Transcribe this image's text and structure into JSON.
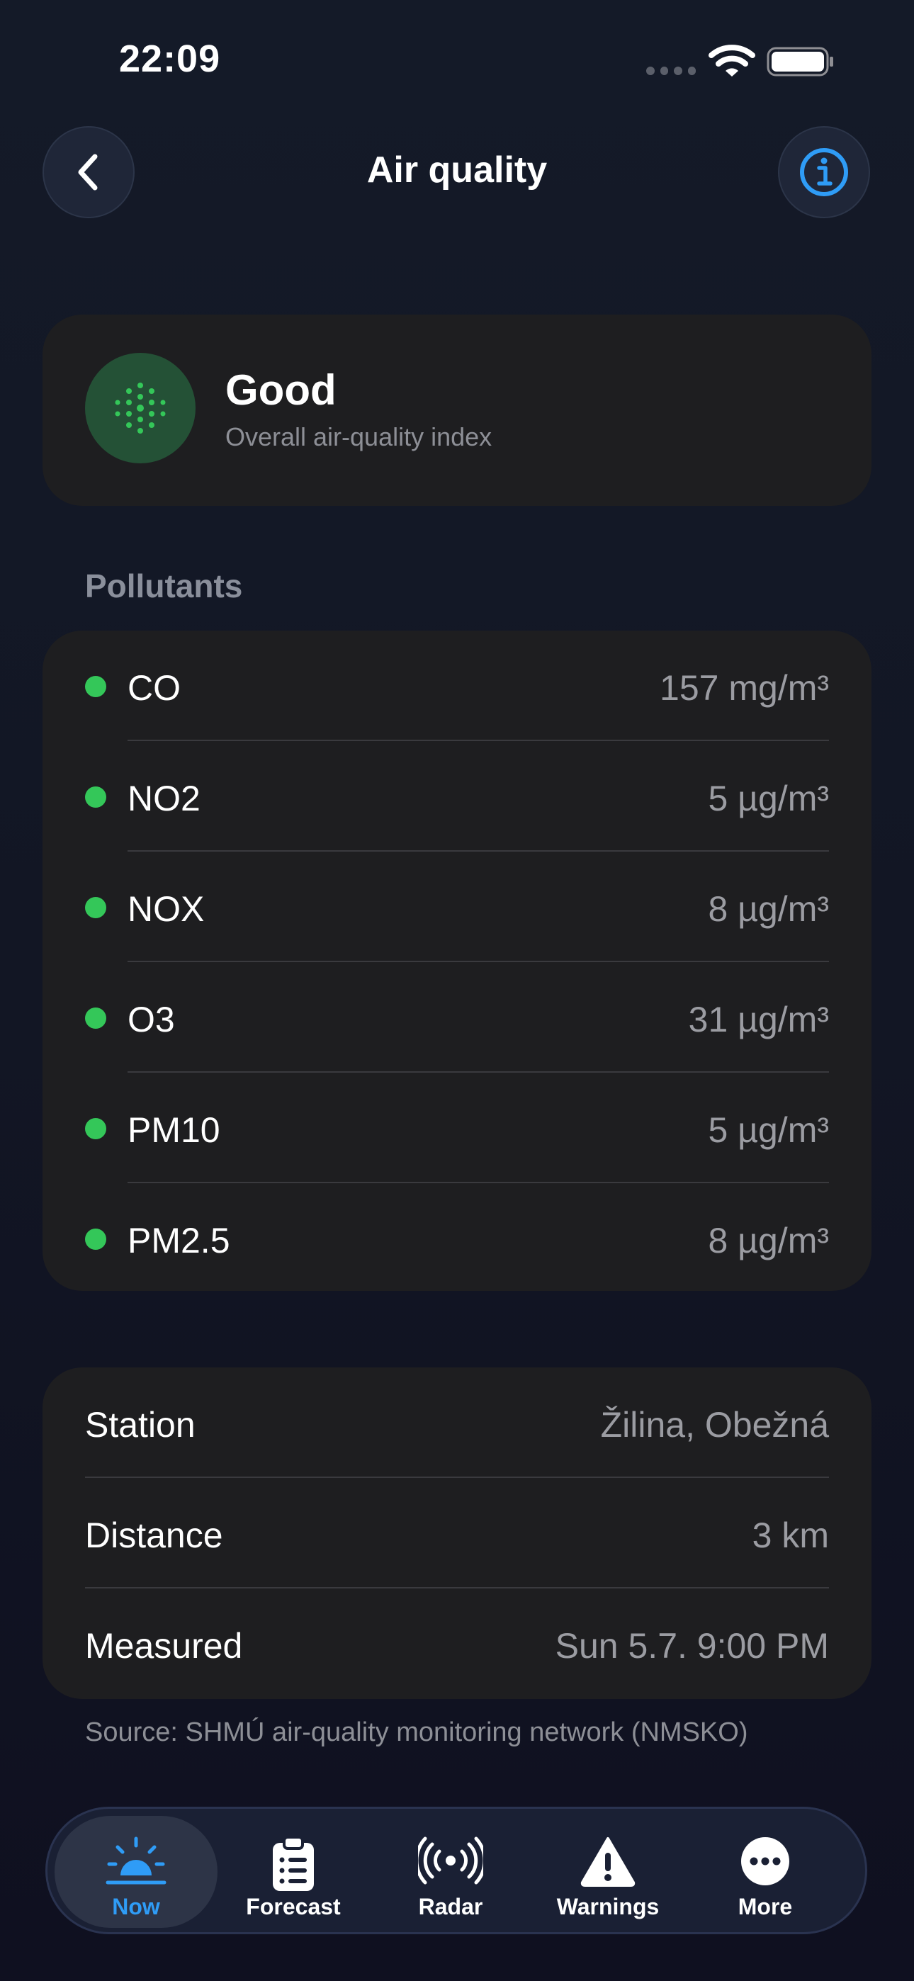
{
  "status_bar": {
    "time": "22:09"
  },
  "header": {
    "title": "Air quality"
  },
  "aqi": {
    "label": "Good",
    "subtitle": "Overall air-quality index",
    "color": "#34c759"
  },
  "pollutants": {
    "section_title": "Pollutants",
    "items": [
      {
        "name": "CO",
        "value": "157 mg/m³"
      },
      {
        "name": "NO2",
        "value": "5 µg/m³"
      },
      {
        "name": "NOX",
        "value": "8 µg/m³"
      },
      {
        "name": "O3",
        "value": "31 µg/m³"
      },
      {
        "name": "PM10",
        "value": "5 µg/m³"
      },
      {
        "name": "PM2.5",
        "value": "8 µg/m³"
      }
    ]
  },
  "station_info": {
    "rows": [
      {
        "label": "Station",
        "value": "Žilina, Obežná"
      },
      {
        "label": "Distance",
        "value": "3 km"
      },
      {
        "label": "Measured",
        "value": "Sun 5.7. 9:00 PM"
      }
    ]
  },
  "source": "Source: SHMÚ air-quality monitoring network (NMSKO)",
  "tabbar": {
    "active": "now",
    "accent_color": "#2f9cf6",
    "tabs": [
      {
        "id": "now",
        "label": "Now",
        "icon": "sunrise-icon"
      },
      {
        "id": "forecast",
        "label": "Forecast",
        "icon": "clipboard-list-icon"
      },
      {
        "id": "radar",
        "label": "Radar",
        "icon": "antenna-signal-icon"
      },
      {
        "id": "warnings",
        "label": "Warnings",
        "icon": "warning-triangle-icon"
      },
      {
        "id": "more",
        "label": "More",
        "icon": "ellipsis-circle-icon"
      }
    ]
  }
}
